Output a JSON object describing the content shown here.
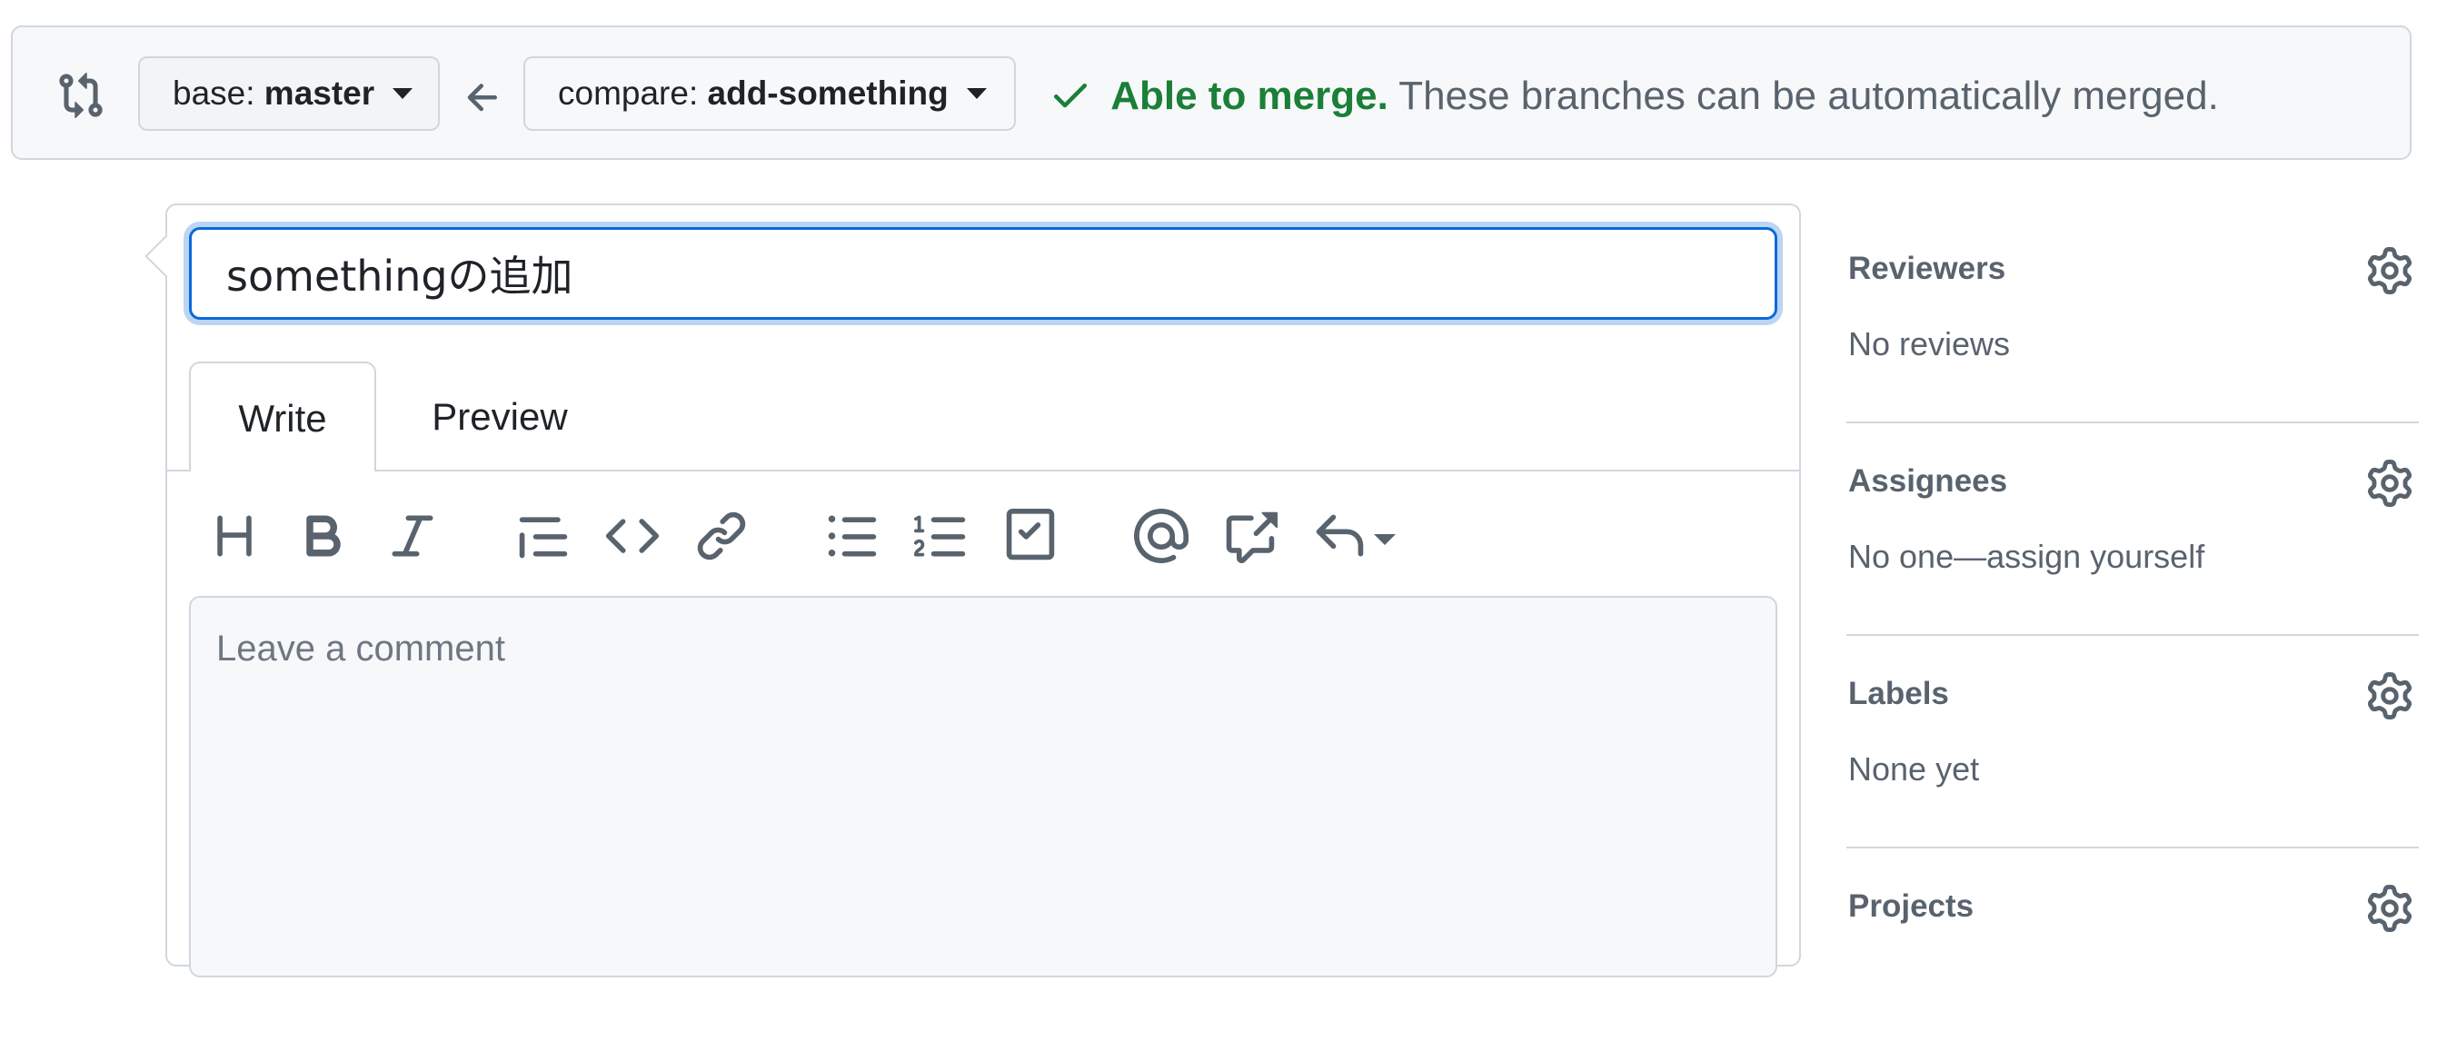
{
  "compare": {
    "base_label": "base:",
    "base_branch": "master",
    "compare_label": "compare:",
    "compare_branch": "add-something",
    "merge_ok": "Able to merge.",
    "merge_message": "These branches can be automatically merged."
  },
  "pull_request": {
    "title_value": "somethingの追加",
    "tabs": [
      {
        "label": "Write",
        "active": true
      },
      {
        "label": "Preview",
        "active": false
      }
    ],
    "comment_placeholder": "Leave a comment",
    "toolbar_icons": [
      "heading-icon",
      "bold-icon",
      "italic-icon",
      "quote-icon",
      "code-icon",
      "link-icon",
      "bulleted-list-icon",
      "numbered-list-icon",
      "task-list-icon",
      "mention-icon",
      "cross-reference-icon",
      "reply-icon"
    ]
  },
  "sidebar": {
    "sections": [
      {
        "title": "Reviewers",
        "value": "No reviews"
      },
      {
        "title": "Assignees",
        "value": "No one—assign yourself"
      },
      {
        "title": "Labels",
        "value": "None yet"
      },
      {
        "title": "Projects",
        "value": ""
      }
    ]
  },
  "colors": {
    "accent": "#0969da",
    "success": "#1a7f37",
    "muted": "#59636e",
    "border": "#d0d7de",
    "canvas_subtle": "#f6f8fa"
  }
}
